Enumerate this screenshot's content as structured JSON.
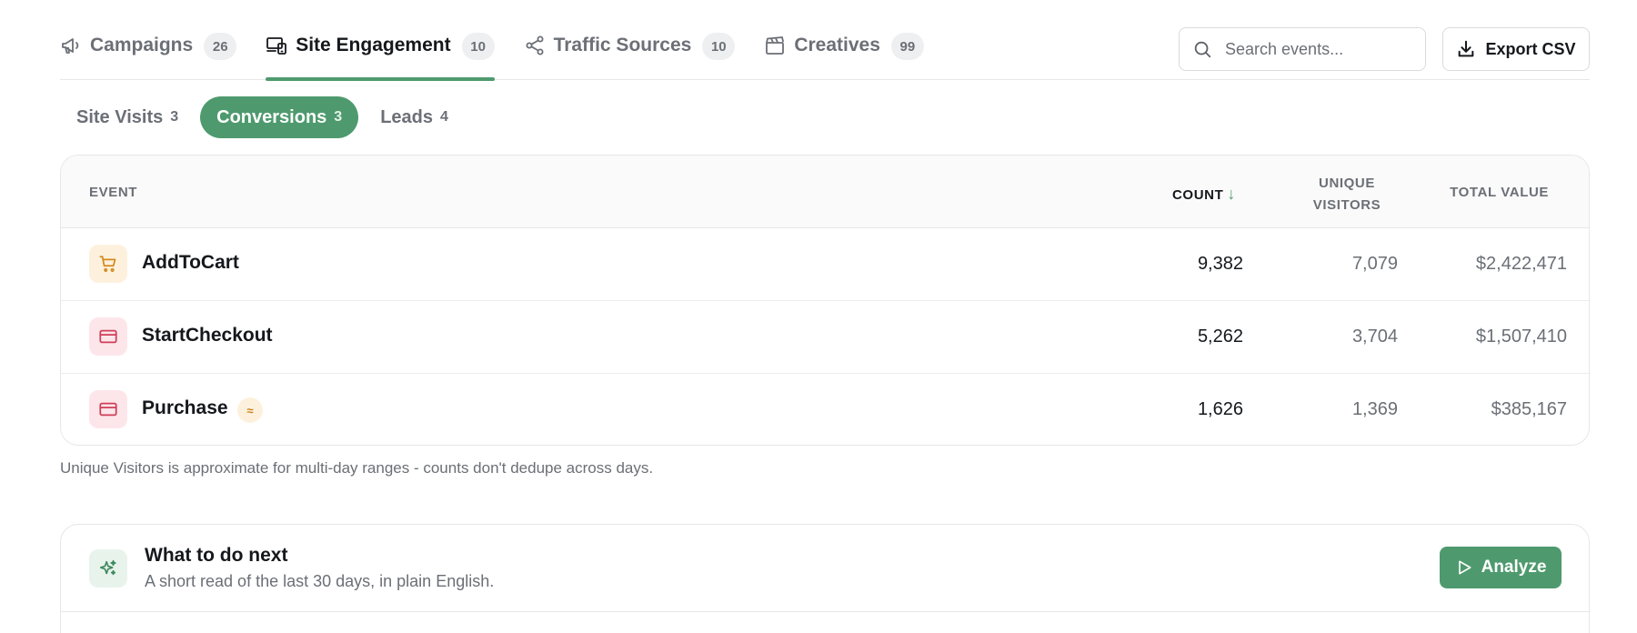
{
  "colors": {
    "accent": "#4e9a6e",
    "muted": "#6b6f76",
    "text": "#15181c",
    "cart_icon": "#d48a1c",
    "card_icon": "#cf3d57"
  },
  "tabs": [
    {
      "label": "Campaigns",
      "count": "26",
      "icon": "megaphone-icon",
      "active": false
    },
    {
      "label": "Site Engagement",
      "count": "10",
      "icon": "devices-icon",
      "active": true
    },
    {
      "label": "Traffic Sources",
      "count": "10",
      "icon": "share-icon",
      "active": false
    },
    {
      "label": "Creatives",
      "count": "99",
      "icon": "clapperboard-icon",
      "active": false
    }
  ],
  "search": {
    "placeholder": "Search events...",
    "value": ""
  },
  "export": {
    "label": "Export CSV"
  },
  "subtabs": [
    {
      "label": "Site Visits",
      "count": "3",
      "active": false
    },
    {
      "label": "Conversions",
      "count": "3",
      "active": true
    },
    {
      "label": "Leads",
      "count": "4",
      "active": false
    }
  ],
  "table": {
    "headers": {
      "event": "EVENT",
      "count": "COUNT",
      "sort_arrow": "↓",
      "unique_line1": "UNIQUE",
      "unique_line2": "VISITORS",
      "total": "TOTAL VALUE"
    },
    "rows": [
      {
        "event": "AddToCart",
        "icon": "cart-icon",
        "count": "9,382",
        "unique": "7,079",
        "total": "$2,422,471",
        "approx": ""
      },
      {
        "event": "StartCheckout",
        "icon": "credit-card-icon",
        "count": "5,262",
        "unique": "3,704",
        "total": "$1,507,410",
        "approx": ""
      },
      {
        "event": "Purchase",
        "icon": "credit-card-icon",
        "count": "1,626",
        "unique": "1,369",
        "total": "$385,167",
        "approx": "≈"
      }
    ]
  },
  "note": "Unique Visitors is approximate for multi-day ranges - counts don't dedupe across days.",
  "next": {
    "title": "What to do next",
    "subtitle": "A short read of the last 30 days, in plain English.",
    "button": "Analyze",
    "icon": "sparkles-icon"
  }
}
